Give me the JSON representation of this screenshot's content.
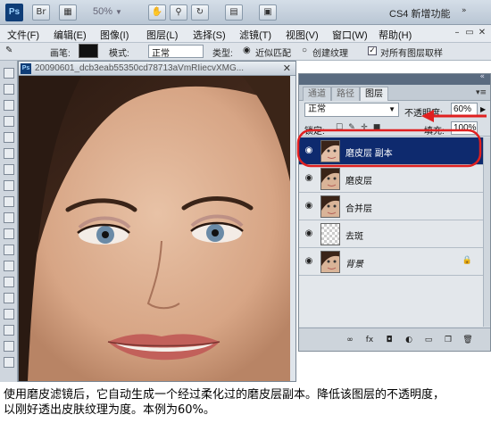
{
  "appbar": {
    "logo": "Ps",
    "zoom": "50%",
    "workspace": "CS4 新增功能",
    "colors": {
      "bar": "#c9d3de",
      "logo": "#0f3d77"
    }
  },
  "menu": {
    "items": [
      "文件(F)",
      "编辑(E)",
      "图像(I)",
      "图层(L)",
      "选择(S)",
      "滤镜(T)",
      "视图(V)",
      "窗口(W)",
      "帮助(H)"
    ]
  },
  "options": {
    "brush_label": "画笔:",
    "mode_label": "模式:",
    "mode_value": "正常",
    "type_label": "类型:",
    "proximity_label": "近似匹配",
    "create_texture_label": "创建纹理",
    "sample_all_label": "对所有图层取样",
    "sample_all_checked": "✓"
  },
  "document": {
    "title": "20090601_dcb3eab55350cd78713aVmRIiecvXMG..."
  },
  "layers_panel": {
    "tabs": [
      "通道",
      "路径",
      "图层"
    ],
    "active_tab": "图层",
    "blend_mode": "正常",
    "opacity_label": "不透明度:",
    "opacity_value": "60%",
    "lock_label": "锁定:",
    "fill_label": "填充:",
    "fill_value": "100%",
    "selected_color": "#0e2a6e",
    "layers": [
      {
        "name": "磨皮层 副本",
        "selected": true,
        "thumb": "face",
        "italic": false
      },
      {
        "name": "磨皮层",
        "selected": false,
        "thumb": "face",
        "italic": false
      },
      {
        "name": "合并层",
        "selected": false,
        "thumb": "face",
        "italic": false
      },
      {
        "name": "去斑",
        "selected": false,
        "thumb": "transparent",
        "italic": false
      },
      {
        "name": "背景",
        "selected": false,
        "thumb": "face",
        "italic": true,
        "locked": true
      }
    ]
  },
  "annotation": {
    "color": "#e02020"
  },
  "caption": {
    "line1": "使用磨皮滤镜后，它自动生成一个经过柔化过的磨皮层副本。降低该图层的不透明度，",
    "line2": "以刚好透出皮肤纹理为度。本例为60%。"
  }
}
